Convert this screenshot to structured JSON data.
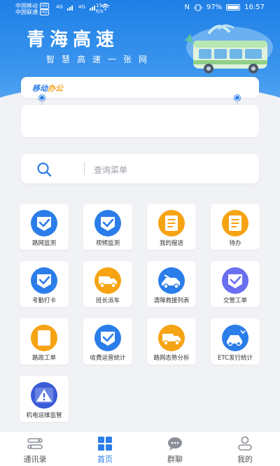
{
  "status_bar": {
    "carrier1": "中国移动",
    "carrier1_tag": "HD",
    "carrier2": "中国联通",
    "carrier2_tag": "HD",
    "net1": "4G",
    "net2": "4G",
    "speed_value": "15.6",
    "speed_unit": "K/s",
    "nfc": "N",
    "vibrate": "",
    "battery": "97%",
    "battery_level": 0.97,
    "time": "16:57"
  },
  "header": {
    "title": "青海高速",
    "subtitle": "智慧高速一张网"
  },
  "card": {
    "tab_label_blue": "移动",
    "tab_label_orange": "办公"
  },
  "search": {
    "placeholder": "查询菜单",
    "icon": "search-icon"
  },
  "menu": [
    {
      "label": "路网监测",
      "icon": "check-shield-icon",
      "color": "#2b7de9"
    },
    {
      "label": "视频监测",
      "icon": "check-shield-icon",
      "color": "#2b7de9"
    },
    {
      "label": "我的报送",
      "icon": "document-icon",
      "color": "#f6a314"
    },
    {
      "label": "待办",
      "icon": "document-icon",
      "color": "#f6a314"
    },
    {
      "label": "考勤打卡",
      "icon": "check-shield-icon",
      "color": "#2b7de9"
    },
    {
      "label": "班长派车",
      "icon": "truck-icon",
      "color": "#f6a314"
    },
    {
      "label": "清障救援列表",
      "icon": "tow-truck-icon",
      "color": "#2b7de9"
    },
    {
      "label": "交警工单",
      "icon": "check-shield-icon",
      "color": "#6a6ef0"
    },
    {
      "label": "路政工单",
      "icon": "blank-doc-icon",
      "color": "#f6a314"
    },
    {
      "label": "收费运营统计",
      "icon": "check-shield-icon",
      "color": "#2b7de9"
    },
    {
      "label": "路网态势分析",
      "icon": "truck-icon",
      "color": "#f6a314"
    },
    {
      "label": "ETC发行统计",
      "icon": "car-crash-icon",
      "color": "#2b7de9"
    },
    {
      "label": "机电运维监管",
      "icon": "warning-icon",
      "color": "#3a5bd9"
    }
  ],
  "bottom_nav": [
    {
      "label": "通讯录",
      "icon": "contacts-icon"
    },
    {
      "label": "首页",
      "icon": "home-grid-icon"
    },
    {
      "label": "群聊",
      "icon": "chat-icon"
    },
    {
      "label": "我的",
      "icon": "user-icon"
    }
  ],
  "colors": {
    "accent": "#2b7de9",
    "orange": "#f6a314",
    "header_top": "#1f7fe6"
  }
}
